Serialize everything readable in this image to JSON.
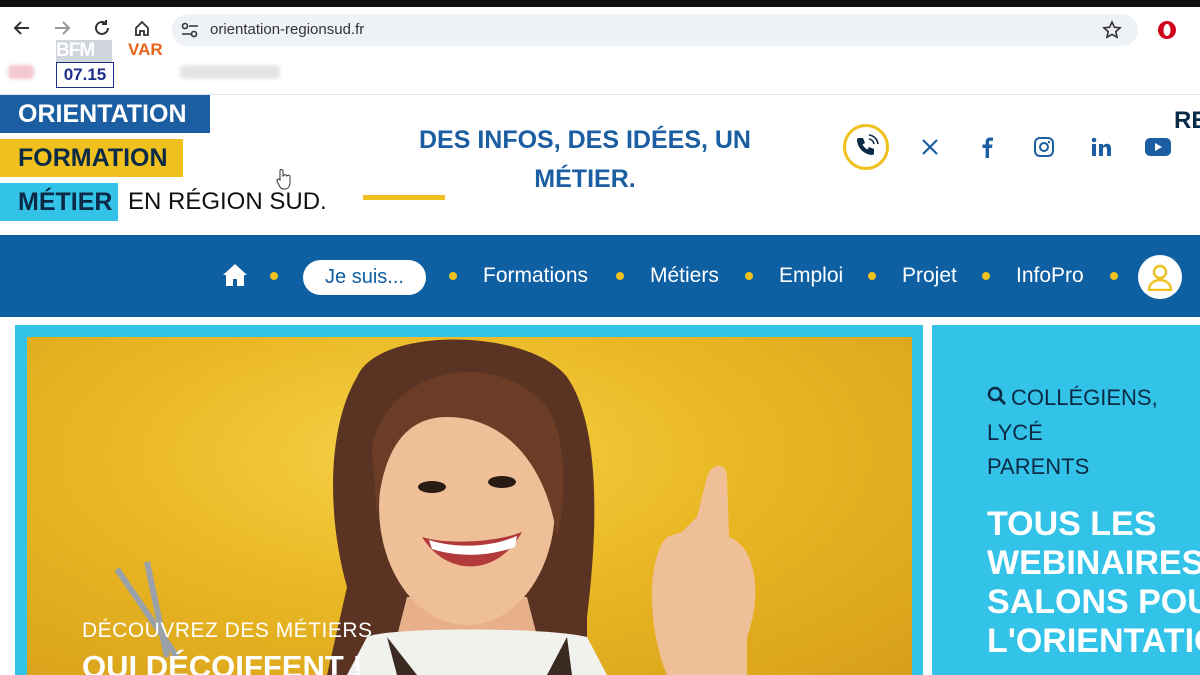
{
  "browser": {
    "url": "orientation-regionsud.fr"
  },
  "overlay": {
    "channel": "BFM",
    "region": "VAR",
    "time": "07.15"
  },
  "logo": {
    "line1": "ORIENTATION",
    "line2": "FORMATION",
    "line3a": "MÉTIER",
    "line3b": "EN RÉGION SUD."
  },
  "tagline": {
    "line1": "DES INFOS, DES IDÉES, UN",
    "line2": "MÉTIER."
  },
  "header_cutoff": "RE",
  "nav": {
    "je_suis": "Je suis...",
    "items": [
      "Formations",
      "Métiers",
      "Emploi",
      "Projet",
      "InfoPro"
    ]
  },
  "hero": {
    "small": "DÉCOUVREZ DES MÉTIERS",
    "big": "QUI DÉCOIFFENT !"
  },
  "side_panel": {
    "search_line1": "COLLÉGIENS, LYCÉ",
    "search_line2": "PARENTS",
    "headline": [
      "TOUS LES",
      "WEBINAIRES",
      "SALONS POU",
      "L'ORIENTATIO"
    ]
  },
  "icons": {
    "back": "arrow-left-icon",
    "forward": "arrow-right-icon",
    "reload": "reload-icon",
    "home": "home-icon",
    "site_info": "tune-icon",
    "bookmark": "star-icon",
    "opera": "opera-icon",
    "phone": "phone-icon",
    "x": "x-icon",
    "facebook": "facebook-icon",
    "instagram": "instagram-icon",
    "linkedin": "linkedin-icon",
    "youtube": "youtube-icon",
    "nav_home": "home-icon",
    "user": "user-icon",
    "search": "search-icon"
  },
  "colors": {
    "brand_blue": "#0f5fa3",
    "cyan": "#33c3e8",
    "yellow": "#f0c01e"
  }
}
